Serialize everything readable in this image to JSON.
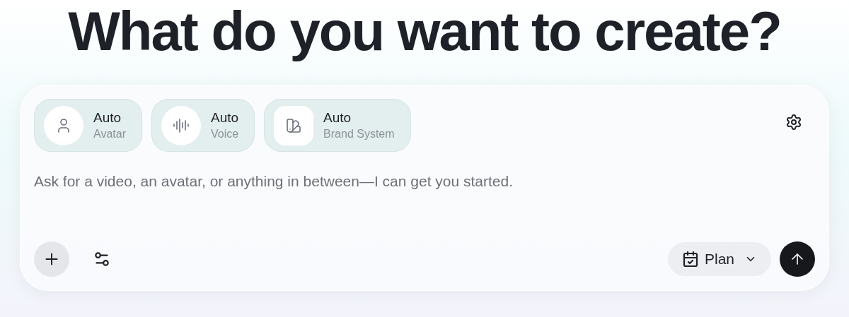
{
  "heading": "What do you want to create?",
  "chips": [
    {
      "kind": "avatar",
      "title": "Auto",
      "subtitle": "Avatar"
    },
    {
      "kind": "voice",
      "title": "Auto",
      "subtitle": "Voice"
    },
    {
      "kind": "brand",
      "title": "Auto",
      "subtitle": "Brand System"
    }
  ],
  "prompt": {
    "placeholder": "Ask for a video, an avatar, or anything in between—I can get you started."
  },
  "mode_button": {
    "label": "Plan"
  }
}
